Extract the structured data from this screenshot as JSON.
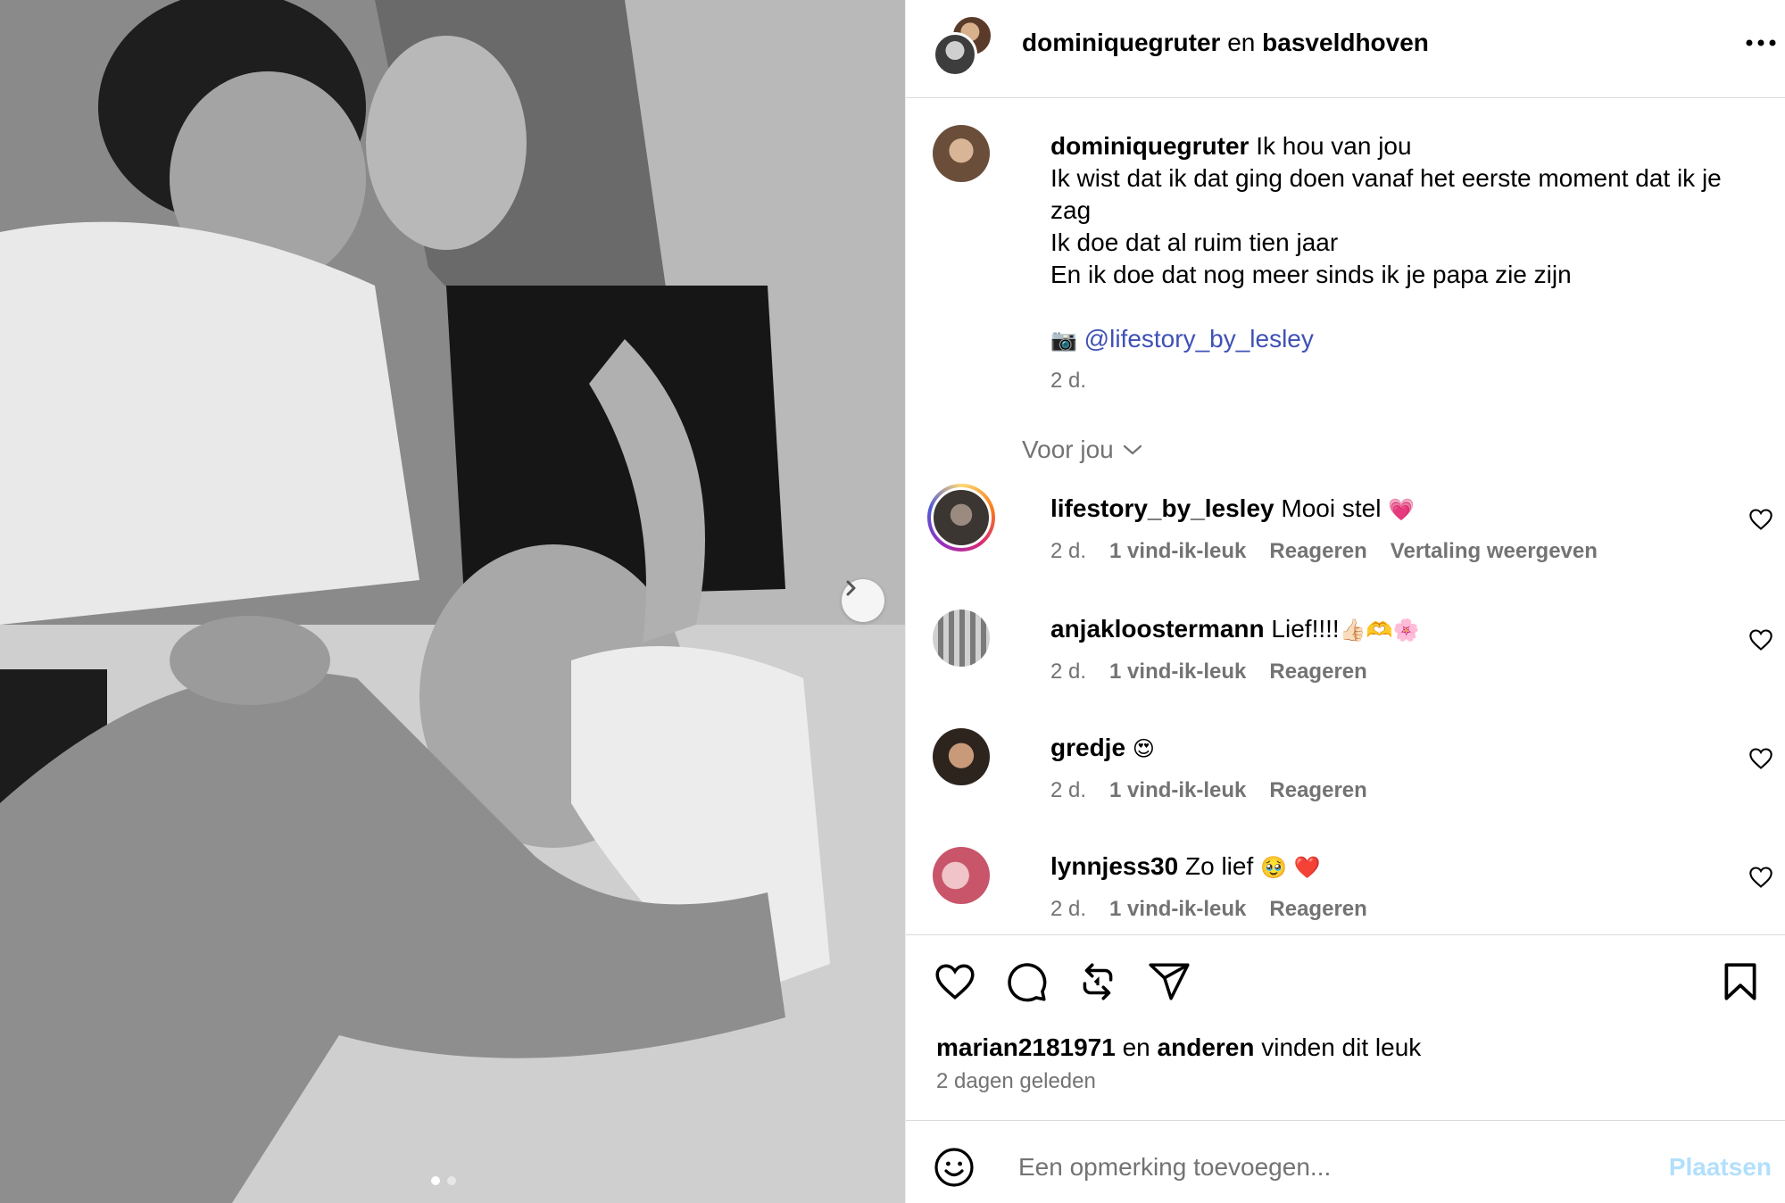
{
  "header": {
    "user1": "dominiquegruter",
    "joiner": "en",
    "user2": "basveldhoven"
  },
  "caption": {
    "username": "dominiquegruter",
    "line1": "Ik hou van jou",
    "line2": "Ik wist dat ik dat ging doen vanaf het eerste moment dat ik je zag",
    "line3": "Ik doe dat al ruim tien jaar",
    "line4": "En ik doe dat nog meer sinds ik je papa zie zijn",
    "camera_emoji": "📷",
    "mention": "@lifestory_by_lesley",
    "time": "2 d."
  },
  "voor_jou": "Voor jou",
  "comments": [
    {
      "username": "lifestory_by_lesley",
      "text": "Mooi stel",
      "emoji": "💗",
      "time": "2 d.",
      "likes": "1 vind-ik-leuk",
      "reply": "Reageren",
      "translate": "Vertaling weergeven"
    },
    {
      "username": "anjakloostermann",
      "text": "Lief!!!!",
      "emoji": "👍🏻🫶🌸",
      "time": "2 d.",
      "likes": "1 vind-ik-leuk",
      "reply": "Reageren"
    },
    {
      "username": "gredje",
      "text": "",
      "emoji": "😍",
      "time": "2 d.",
      "likes": "1 vind-ik-leuk",
      "reply": "Reageren"
    },
    {
      "username": "lynnjess30",
      "text": "Zo lief",
      "emoji": "🥹 ❤️",
      "time": "2 d.",
      "likes": "1 vind-ik-leuk",
      "reply": "Reageren"
    }
  ],
  "likes": {
    "user": "marian2181971",
    "joiner": "en",
    "others": "anderen",
    "suffix": "vinden dit leuk"
  },
  "time_ago": "2 dagen geleden",
  "comment_box": {
    "placeholder": "Een opmerking toevoegen...",
    "post_label": "Plaatsen"
  },
  "carousel": {
    "current": 1,
    "total": 2
  },
  "colors": {
    "mention": "#3f51b5",
    "muted": "#737373",
    "post_disabled": "#b2dffc",
    "divider": "#dbdbdb"
  }
}
